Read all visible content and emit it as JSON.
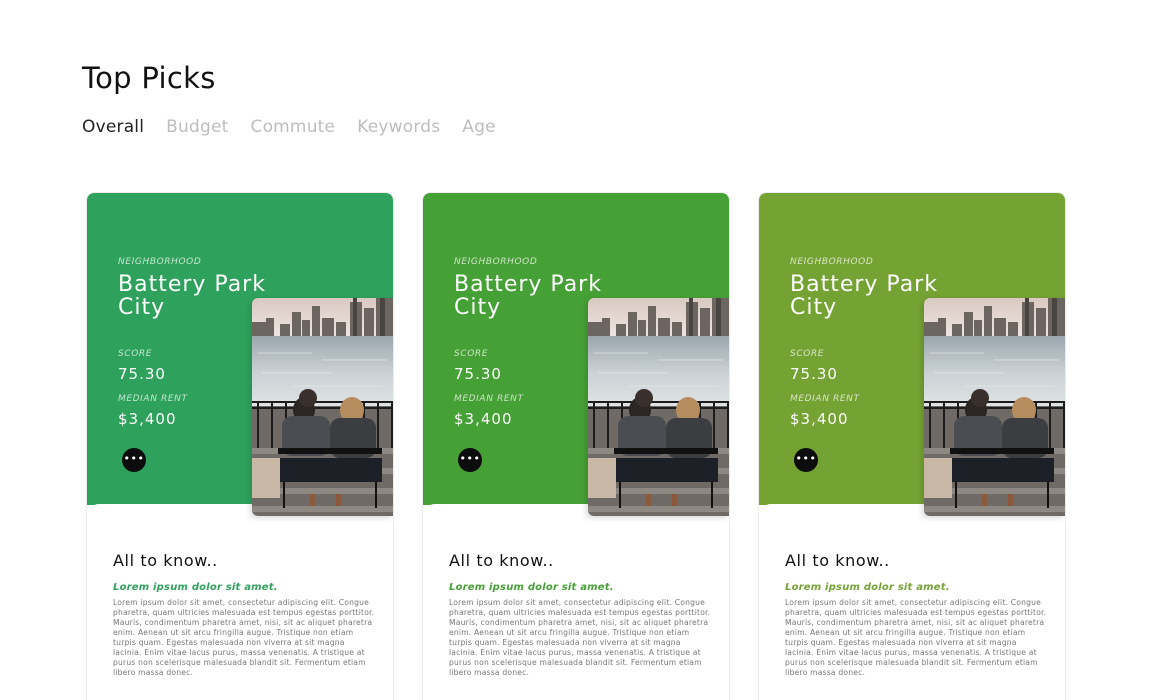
{
  "page": {
    "title": "Top Picks"
  },
  "tabs": [
    {
      "label": "Overall",
      "active": true
    },
    {
      "label": "Budget",
      "active": false
    },
    {
      "label": "Commute",
      "active": false
    },
    {
      "label": "Keywords",
      "active": false
    },
    {
      "label": "Age",
      "active": false
    }
  ],
  "cards": [
    {
      "accent": "#2ea25c",
      "neighborhood_label": "NEIGHBORHOOD",
      "name": "Battery Park City",
      "score_label": "SCORE",
      "score": "75.30",
      "rent_label": "MEDIAN RENT",
      "rent": "$3,400",
      "more_glyph": "•••",
      "know_title": "All to know..",
      "know_sub": "Lorem ipsum dolor sit amet.",
      "know_body": "Lorem ipsum dolor sit amet, consectetur adipiscing elit. Congue pharetra, quam ultricies malesuada est tempus egestas porttitor. Mauris, condimentum pharetra amet, nisi, sit ac aliquet pharetra enim. Aenean ut sit arcu fringilla augue. Tristique non etiam turpis quam. Egestas malesuada non viverra at sit magna lacinia. Enim vitae lacus purus, massa venenatis. A tristique at purus non scelerisque malesuada blandit sit. Fermentum etiam libero massa donec."
    },
    {
      "accent": "#45a035",
      "neighborhood_label": "NEIGHBORHOOD",
      "name": "Battery Park City",
      "score_label": "SCORE",
      "score": "75.30",
      "rent_label": "MEDIAN RENT",
      "rent": "$3,400",
      "more_glyph": "•••",
      "know_title": "All to know..",
      "know_sub": "Lorem ipsum dolor sit amet.",
      "know_body": "Lorem ipsum dolor sit amet, consectetur adipiscing elit. Congue pharetra, quam ultricies malesuada est tempus egestas porttitor. Mauris, condimentum pharetra amet, nisi, sit ac aliquet pharetra enim. Aenean ut sit arcu fringilla augue. Tristique non etiam turpis quam. Egestas malesuada non viverra at sit magna lacinia. Enim vitae lacus purus, massa venenatis. A tristique at purus non scelerisque malesuada blandit sit. Fermentum etiam libero massa donec."
    },
    {
      "accent": "#74a233",
      "neighborhood_label": "NEIGHBORHOOD",
      "name": "Battery Park City",
      "score_label": "SCORE",
      "score": "75.30",
      "rent_label": "MEDIAN RENT",
      "rent": "$3,400",
      "more_glyph": "•••",
      "know_title": "All to know..",
      "know_sub": "Lorem ipsum dolor sit amet.",
      "know_body": "Lorem ipsum dolor sit amet, consectetur adipiscing elit. Congue pharetra, quam ultricies malesuada est tempus egestas porttitor. Mauris, condimentum pharetra amet, nisi, sit ac aliquet pharetra enim. Aenean ut sit arcu fringilla augue. Tristique non etiam turpis quam. Egestas malesuada non viverra at sit magna lacinia. Enim vitae lacus purus, massa venenatis. A tristique at purus non scelerisque malesuada blandit sit. Fermentum etiam libero massa donec."
    }
  ]
}
